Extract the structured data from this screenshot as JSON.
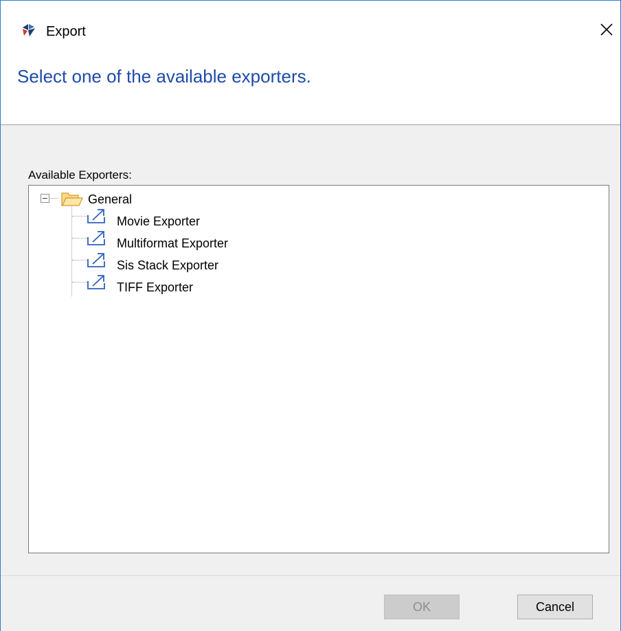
{
  "window": {
    "title": "Export"
  },
  "header": {
    "instruction": "Select one of the available exporters."
  },
  "content": {
    "group_label": "Available Exporters:",
    "tree": {
      "root_label": "General",
      "items": [
        {
          "label": "Movie Exporter"
        },
        {
          "label": "Multiformat Exporter"
        },
        {
          "label": "Sis Stack Exporter"
        },
        {
          "label": "TIFF Exporter"
        }
      ]
    }
  },
  "footer": {
    "ok_label": "OK",
    "ok_enabled": false,
    "cancel_label": "Cancel"
  },
  "colors": {
    "header_text": "#1e4ba8",
    "window_border": "#2b79d8",
    "panel_background": "#f0f0f0",
    "disabled_button": "#cccccc"
  },
  "icons": {
    "app": "app-logo-icon",
    "close": "close-icon",
    "folder": "folder-open-icon",
    "exporter": "export-arrow-icon",
    "expander": "collapse-minus-icon"
  }
}
